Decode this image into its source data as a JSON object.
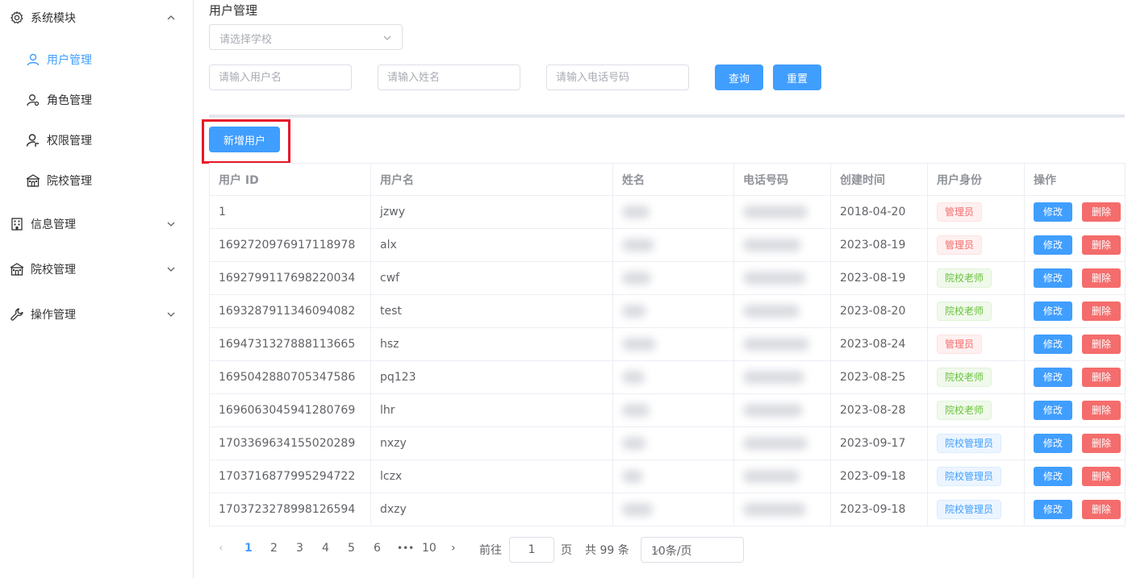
{
  "sidebar": {
    "system_group": "系统模块",
    "items": [
      {
        "label": "用户管理"
      },
      {
        "label": "角色管理"
      },
      {
        "label": "权限管理"
      },
      {
        "label": "院校管理"
      }
    ],
    "groups": [
      {
        "label": "信息管理"
      },
      {
        "label": "院校管理"
      },
      {
        "label": "操作管理"
      }
    ]
  },
  "header": {
    "title": "用户管理"
  },
  "filters": {
    "school_placeholder": "请选择学校",
    "username_placeholder": "请输入用户名",
    "name_placeholder": "请输入姓名",
    "phone_placeholder": "请输入电话号码",
    "query_label": "查询",
    "reset_label": "重置"
  },
  "toolbar": {
    "add_user_label": "新增用户"
  },
  "table": {
    "columns": [
      "用户 ID",
      "用户名",
      "姓名",
      "电话号码",
      "创建时间",
      "用户身份",
      "操作"
    ],
    "edit_label": "修改",
    "delete_label": "删除",
    "rows": [
      {
        "id": "1",
        "username": "jzwy",
        "created": "2018-04-20",
        "role": "管理员",
        "role_type": "danger"
      },
      {
        "id": "1692720976917118978",
        "username": "alx",
        "created": "2023-08-19",
        "role": "管理员",
        "role_type": "danger"
      },
      {
        "id": "1692799117698220034",
        "username": "cwf",
        "created": "2023-08-19",
        "role": "院校老师",
        "role_type": "success"
      },
      {
        "id": "1693287911346094082",
        "username": "test",
        "created": "2023-08-20",
        "role": "院校老师",
        "role_type": "success"
      },
      {
        "id": "1694731327888113665",
        "username": "hsz",
        "created": "2023-08-24",
        "role": "管理员",
        "role_type": "danger"
      },
      {
        "id": "1695042880705347586",
        "username": "pq123",
        "created": "2023-08-25",
        "role": "院校老师",
        "role_type": "success"
      },
      {
        "id": "1696063045941280769",
        "username": "lhr",
        "created": "2023-08-28",
        "role": "院校老师",
        "role_type": "success"
      },
      {
        "id": "1703369634155020289",
        "username": "nxzy",
        "created": "2023-09-17",
        "role": "院校管理员",
        "role_type": "info"
      },
      {
        "id": "1703716877995294722",
        "username": "lczx",
        "created": "2023-09-18",
        "role": "院校管理员",
        "role_type": "info"
      },
      {
        "id": "1703723278998126594",
        "username": "dxzy",
        "created": "2023-09-18",
        "role": "院校管理员",
        "role_type": "info"
      }
    ]
  },
  "pagination": {
    "pages": [
      "1",
      "2",
      "3",
      "4",
      "5",
      "6",
      "•••",
      "10"
    ],
    "current": "1",
    "goto_label": "前往",
    "goto_value": "1",
    "page_unit": "页",
    "total_text": "共 99 条",
    "page_size": "10条/页"
  },
  "colors": {
    "primary": "#409eff",
    "danger": "#f56c6c",
    "success": "#67c23a",
    "highlight": "#e8172a"
  }
}
